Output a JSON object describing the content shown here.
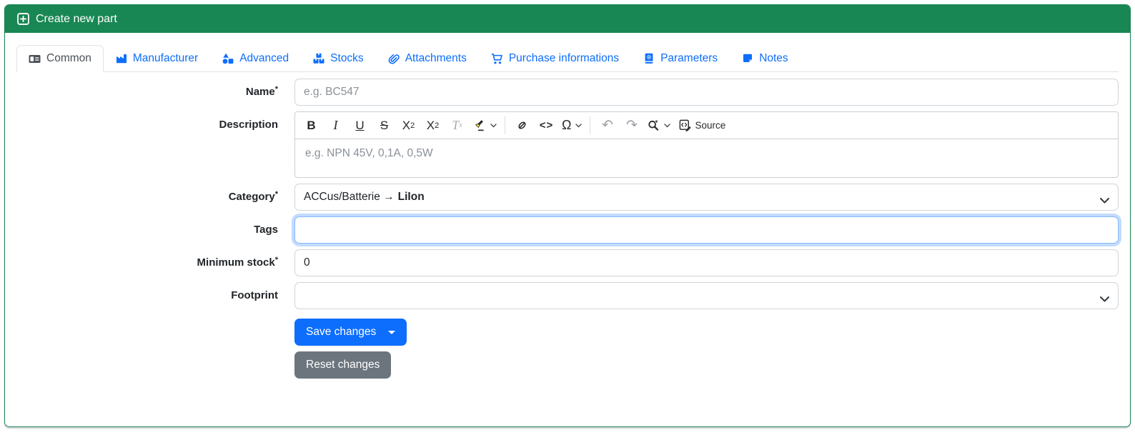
{
  "colors": {
    "header_green": "#198754",
    "primary_blue": "#0d6efd",
    "secondary_gray": "#6c757d",
    "tab_active_text": "#495057",
    "marker_yellow": "#f5e642",
    "focus_ring_blue": "#86b7fe"
  },
  "header": {
    "title": "Create new part"
  },
  "tabs": [
    {
      "label": "Common",
      "icon": "id-card-icon",
      "active": true
    },
    {
      "label": "Manufacturer",
      "icon": "industry-icon",
      "active": false
    },
    {
      "label": "Advanced",
      "icon": "shapes-icon",
      "active": false
    },
    {
      "label": "Stocks",
      "icon": "boxes-stacked-icon",
      "active": false
    },
    {
      "label": "Attachments",
      "icon": "paperclip-icon",
      "active": false
    },
    {
      "label": "Purchase informations",
      "icon": "cart-icon",
      "active": false
    },
    {
      "label": "Parameters",
      "icon": "book-icon",
      "active": false
    },
    {
      "label": "Notes",
      "icon": "sticky-note-icon",
      "active": false
    }
  ],
  "form": {
    "required_marker": "*",
    "name": {
      "label": "Name",
      "required": true,
      "value": "",
      "placeholder": "e.g. BC547"
    },
    "description": {
      "label": "Description",
      "required": false,
      "value": "",
      "placeholder": "e.g. NPN 45V, 0,1A, 0,5W"
    },
    "category": {
      "label": "Category",
      "required": true,
      "path_prefix": "ACCus/Batterie →",
      "selected": "LiIon"
    },
    "tags": {
      "label": "Tags",
      "required": false,
      "value": "",
      "focused": true
    },
    "minimum_stock": {
      "label": "Minimum stock",
      "required": true,
      "value": "0"
    },
    "footprint": {
      "label": "Footprint",
      "required": false,
      "value": ""
    }
  },
  "editor": {
    "toolbar": {
      "bold": "B",
      "italic": "I",
      "underline": "U",
      "strikethrough": "S",
      "subscript_base": "X",
      "subscript_sub": "2",
      "superscript_base": "X",
      "superscript_sup": "2",
      "remove_format_base": "T",
      "remove_format_sub": "x",
      "code": "<>",
      "special_char": "Ω",
      "undo": "↶",
      "redo": "↷",
      "source_label": "Source"
    }
  },
  "buttons": {
    "save": "Save changes",
    "reset": "Reset changes"
  }
}
